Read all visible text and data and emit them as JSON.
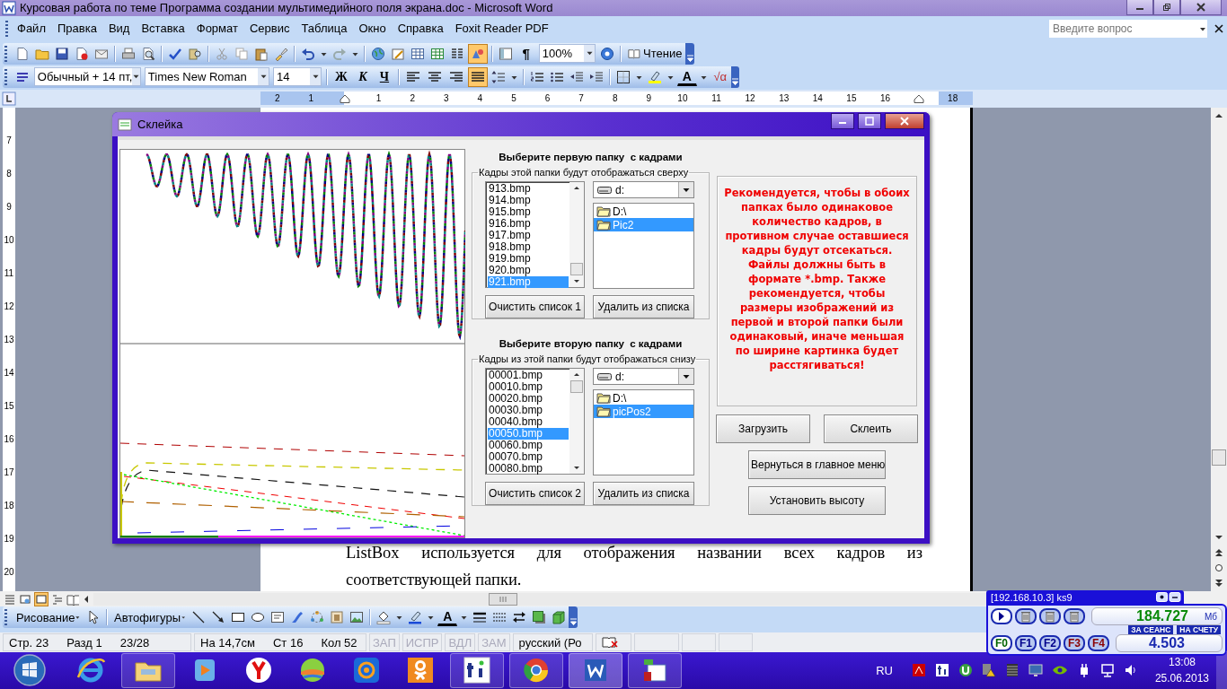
{
  "window": {
    "title": "Курсовая работа по теме Программа создании мультимедийного поля экрана.doc - Microsoft Word"
  },
  "menu": [
    "Файл",
    "Правка",
    "Вид",
    "Вставка",
    "Формат",
    "Сервис",
    "Таблица",
    "Окно",
    "Справка",
    "Foxit Reader PDF"
  ],
  "help_search": {
    "placeholder": "Введите вопрос"
  },
  "standard_toolbar": {
    "drawing_toggle": {
      "on": true
    },
    "formatting_marks": "¶",
    "zoom": "100%",
    "reading_button": "Чтение"
  },
  "formatting_toolbar": {
    "style": "Обычный + 14 пт,",
    "font": "Times New Roman",
    "size": "14",
    "bold": "Ж",
    "italic": "К",
    "underline": "Ч",
    "alignment": [
      {
        "kind": "left",
        "selected": false
      },
      {
        "kind": "center",
        "selected": false
      },
      {
        "kind": "right",
        "selected": false
      },
      {
        "kind": "justify",
        "selected": true
      }
    ],
    "font_color": "A",
    "equation": "√α"
  },
  "ruler": {
    "left_numbers": [
      "2",
      "1"
    ],
    "numbers": [
      "1",
      "2",
      "3",
      "4",
      "5",
      "6",
      "7",
      "8",
      "9",
      "10",
      "11",
      "12",
      "13",
      "14",
      "15",
      "16",
      "18"
    ],
    "vertical_numbers": [
      "7",
      "8",
      "9",
      "10",
      "11",
      "12",
      "13",
      "14",
      "15",
      "16",
      "17",
      "18",
      "19",
      "20"
    ]
  },
  "document": {
    "lines": [
      "ListBox используется для отображения названии всех кадров из",
      "соответствующей папки."
    ]
  },
  "dialog": {
    "title": "Склейка",
    "folders": [
      {
        "heading": "Выберите первую папку  с кадрами",
        "group": "Кадры этой папки будут отображаться сверху",
        "drive": "d:",
        "files": [
          {
            "name": "913.bmp",
            "selected": false
          },
          {
            "name": "914.bmp",
            "selected": false
          },
          {
            "name": "915.bmp",
            "selected": false
          },
          {
            "name": "916.bmp",
            "selected": false
          },
          {
            "name": "917.bmp",
            "selected": false
          },
          {
            "name": "918.bmp",
            "selected": false
          },
          {
            "name": "919.bmp",
            "selected": false
          },
          {
            "name": "920.bmp",
            "selected": false
          },
          {
            "name": "921.bmp",
            "selected": true
          }
        ],
        "directories": [
          {
            "name": "D:\\",
            "selected": false
          },
          {
            "name": "Pic2",
            "selected": true
          }
        ],
        "clear_button": "Очистить список 1",
        "remove_button": "Удалить из списка"
      },
      {
        "heading": "Выберите вторую папку  с кадрами",
        "group": "Кадры из этой папки будут отображаться снизу",
        "drive": "d:",
        "files": [
          {
            "name": "00001.bmp",
            "selected": false
          },
          {
            "name": "00010.bmp",
            "selected": false
          },
          {
            "name": "00020.bmp",
            "selected": false
          },
          {
            "name": "00030.bmp",
            "selected": false
          },
          {
            "name": "00040.bmp",
            "selected": false
          },
          {
            "name": "00050.bmp",
            "selected": true
          },
          {
            "name": "00060.bmp",
            "selected": false
          },
          {
            "name": "00070.bmp",
            "selected": false
          },
          {
            "name": "00080.bmp",
            "selected": false
          }
        ],
        "directories": [
          {
            "name": "D:\\",
            "selected": false
          },
          {
            "name": "picPos2",
            "selected": true
          }
        ],
        "clear_button": "Очистить список 2",
        "remove_button": "Удалить из списка"
      }
    ],
    "note": "Рекомендуется, чтобы в обоих папках было одинаковое количество кадров, в противном случае оставшиеся кадры будут отсекаться. Файлы должны быть в формате *.bmp. Также рекомендуется, чтобы размеры изображений из первой и второй папки были одинаковый, иначе меньшая по ширине картинка будет расстягиваться!",
    "buttons": [
      "Загрузить",
      "Склеить",
      "Вернуться в главное меню",
      "Установить высоту"
    ]
  },
  "drawing_toolbar": {
    "draw_menu": "Рисование",
    "autoshapes_menu": "Автофигуры",
    "font_color": "A"
  },
  "status_bar": {
    "position": [
      "Стр. 23",
      "Разд 1",
      "23/28"
    ],
    "cursor": [
      "На 14,7см",
      "Ст 16",
      "Кол 52"
    ],
    "modes": [
      {
        "label": "ЗАП",
        "on": false
      },
      {
        "label": "ИСПР",
        "on": false
      },
      {
        "label": "ВДЛ",
        "on": false
      },
      {
        "label": "ЗАМ",
        "on": false
      }
    ],
    "language": "русский (Ро"
  },
  "taskbar": {
    "language": "RU",
    "time": "13:08",
    "date": "25.06.2013"
  },
  "traffic_widget": {
    "title": "[192.168.10.3] ks9",
    "traffic": "184.727",
    "unit": "Мб",
    "session_label": "ЗА СЕАНС",
    "account_label": "НА СЧЕТУ",
    "balance": "4.503",
    "keys": [
      {
        "label": "F0",
        "color": "#006400",
        "selected": true
      },
      {
        "label": "F1",
        "color": "#00008b",
        "selected": false
      },
      {
        "label": "F2",
        "color": "#00008b",
        "selected": false
      },
      {
        "label": "F3",
        "color": "#8b0000",
        "selected": false
      },
      {
        "label": "F4",
        "color": "#8b0000",
        "selected": false
      }
    ]
  }
}
